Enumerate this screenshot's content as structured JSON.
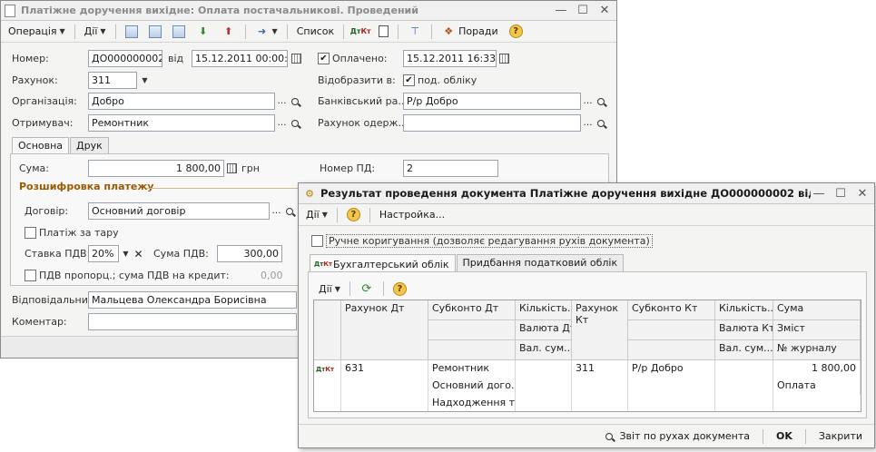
{
  "main_window": {
    "title": "Платіжне доручення вихідне: Оплата постачальникові. Проведений",
    "toolbar": {
      "operation": "Операція",
      "actions": "Дії",
      "list": "Список",
      "tips": "Поради"
    },
    "fields": {
      "number_label": "Номер:",
      "number_value": "ДО000000002",
      "from_label": "від",
      "date_value": "15.12.2011 00:00:00",
      "paid_label": "Оплачено:",
      "paid_date": "15.12.2011 16:33:31",
      "account_label": "Рахунок:",
      "account_value": "311",
      "reflect_label": "Відобразити в:",
      "tax_accounting_label": "под. обліку",
      "org_label": "Організація:",
      "org_value": "Добро",
      "bank_account_label": "Банківський ра...",
      "bank_account_value": "Р/р Добро",
      "recipient_label": "Отримувач:",
      "recipient_value": "Ремонтник",
      "recipient_account_label": "Рахунок одерж...",
      "recipient_account_value": ""
    },
    "tabs": [
      "Основна",
      "Друк"
    ],
    "main_tab": {
      "sum_label": "Сума:",
      "sum_value": "1 800,00",
      "currency": "грн",
      "pd_number_label": "Номер ПД:",
      "pd_number_value": "2",
      "breakdown_title": "Розшифровка платежу",
      "contract_label": "Договір:",
      "contract_value": "Основний договір",
      "tare_label": "Платіж за тару",
      "vat_rate_label": "Ставка ПДВ:",
      "vat_rate_value": "20%",
      "vat_sum_label": "Сума ПДВ:",
      "vat_sum_value": "300,00",
      "vat_prop_label": "ПДВ пропорц.; сума ПДВ на кредит:",
      "vat_prop_value": "0,00"
    },
    "responsible_label": "Відповідальний:",
    "responsible_value": "Мальцева Олександра Борисівна",
    "comment_label": "Коментар:",
    "comment_value": ""
  },
  "result_window": {
    "title": "Результат проведення документа Платіжне доручення вихідне ДО000000002 від 15.12...:31",
    "toolbar": {
      "actions": "Дії",
      "settings": "Настройка..."
    },
    "manual_label": "Ручне коригування (дозволяє редагування рухів документа)",
    "tabs": [
      "Бухгалтерський облік",
      "Придбання податковий облік"
    ],
    "inner_toolbar": {
      "actions": "Дії"
    },
    "table": {
      "headers": {
        "debit_account": "Рахунок Дт",
        "subconto_dt": "Субконто Дт",
        "qty_dt": "Кількість...",
        "currency_dt": "Валюта Дт",
        "cur_sum_dt": "Вал. сум...",
        "credit_account": "Рахунок Кт",
        "subconto_kt": "Субконто Кт",
        "qty_kt": "Кількість...",
        "currency_kt": "Валюта Кт",
        "cur_sum_kt": "Вал. сум...",
        "sum": "Сума",
        "content": "Зміст",
        "journal_no": "№ журналу"
      },
      "row": {
        "debit_account": "631",
        "subconto_dt": [
          "Ремонтник",
          "Основний дого...",
          "Надходження т..."
        ],
        "credit_account": "311",
        "subconto_kt": "Р/р Добро",
        "sum": "1 800,00",
        "content": "Оплата"
      }
    },
    "footer": {
      "report": "Звіт по рухах документа",
      "ok": "OK",
      "close": "Закрити"
    }
  }
}
